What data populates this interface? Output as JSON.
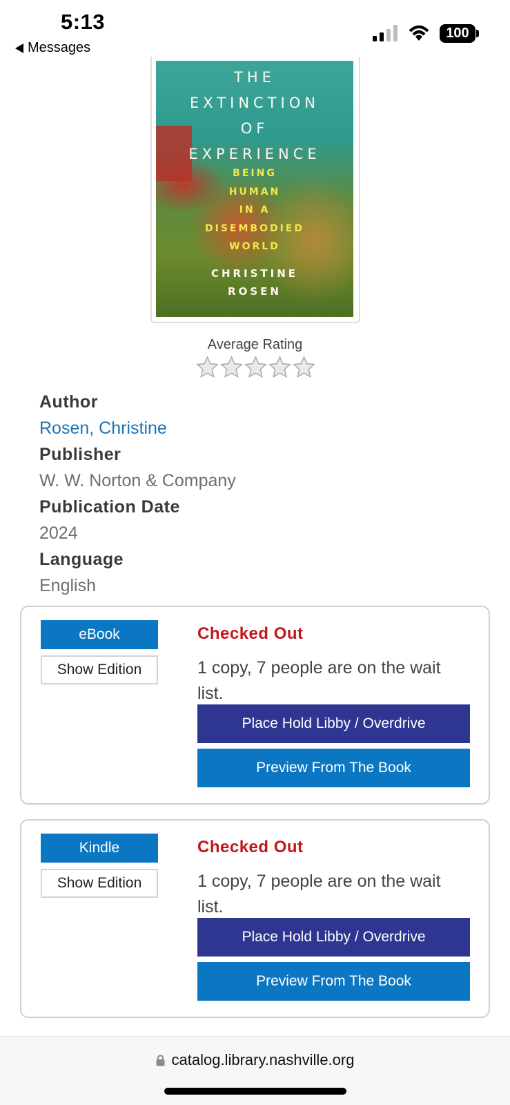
{
  "status_bar": {
    "time": "5:13",
    "back_label": "Messages",
    "battery": "100"
  },
  "book": {
    "cover": {
      "title_lines": [
        "THE",
        "EXTINCTION",
        "OF",
        "EXPERIENCE"
      ],
      "subtitle_lines": [
        "BEING",
        "HUMAN",
        "IN A",
        "DISEMBODIED",
        "WORLD"
      ],
      "author_lines": [
        "CHRISTINE",
        "ROSEN"
      ]
    },
    "rating_label": "Average Rating",
    "rating_value": 0,
    "rating_max": 5,
    "details": {
      "author_label": "Author",
      "author_value": "Rosen, Christine",
      "publisher_label": "Publisher",
      "publisher_value": "W. W. Norton & Company",
      "pubdate_label": "Publication Date",
      "pubdate_value": "2024",
      "language_label": "Language",
      "language_value": "English"
    }
  },
  "formats": [
    {
      "format": "eBook",
      "show_edition": "Show Edition",
      "status": "Checked Out",
      "wait_text": "1 copy, 7 people are on the wait list.",
      "hold_label": "Place Hold Libby / Overdrive",
      "preview_label": "Preview From The Book"
    },
    {
      "format": "Kindle",
      "show_edition": "Show Edition",
      "status": "Checked Out",
      "wait_text": "1 copy, 7 people are on the wait list.",
      "hold_label": "Place Hold Libby / Overdrive",
      "preview_label": "Preview From The Book"
    }
  ],
  "browser": {
    "url": "catalog.library.nashville.org"
  },
  "colors": {
    "format_button": "#0b77c2",
    "hold_button": "#2e3691",
    "status_red": "#c0161c",
    "link_blue": "#1a73b5"
  }
}
